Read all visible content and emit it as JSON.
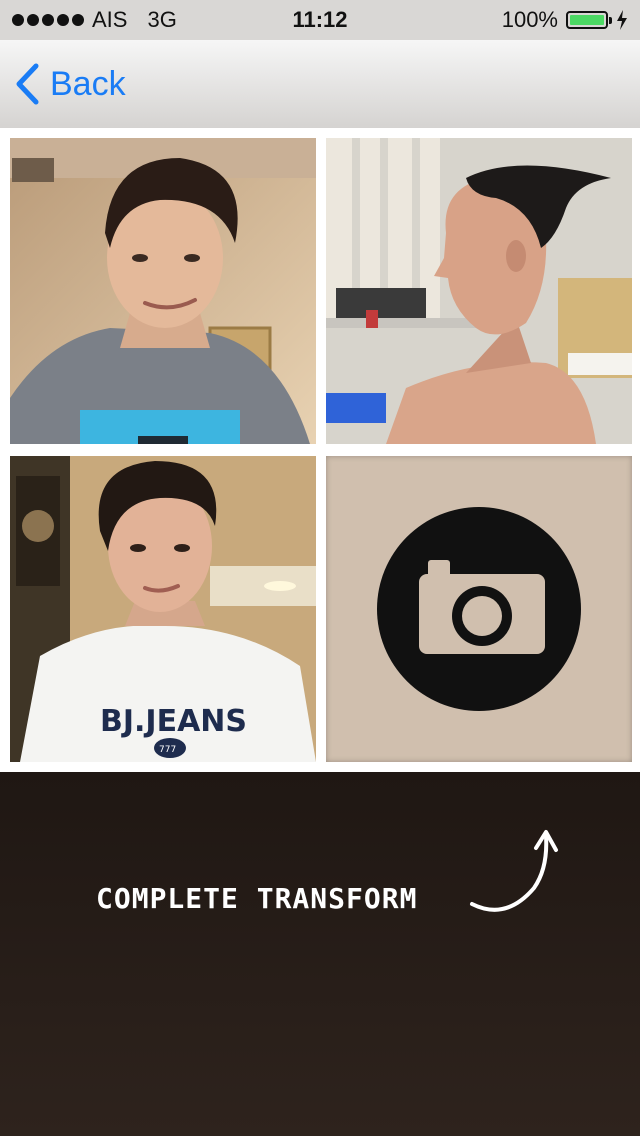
{
  "status_bar": {
    "carrier": "AIS",
    "network": "3G",
    "time": "11:12",
    "battery_percent": "100%",
    "battery_level": 1.0,
    "battery_color": "#4cd964"
  },
  "nav": {
    "back_label": "Back",
    "accent_color": "#1a7cf5"
  },
  "photos": [
    {
      "name": "photo-selfie-smile"
    },
    {
      "name": "photo-profile-side"
    },
    {
      "name": "photo-selfie-tshirt",
      "shirt_text": "BJ.JEANS",
      "badge_text": "777"
    }
  ],
  "camera_button": {
    "icon": "camera-icon",
    "background": "#d0bfae"
  },
  "bottom": {
    "action_label": "COMPLETE TRANSFORM",
    "arrow_icon": "curved-arrow-icon"
  }
}
